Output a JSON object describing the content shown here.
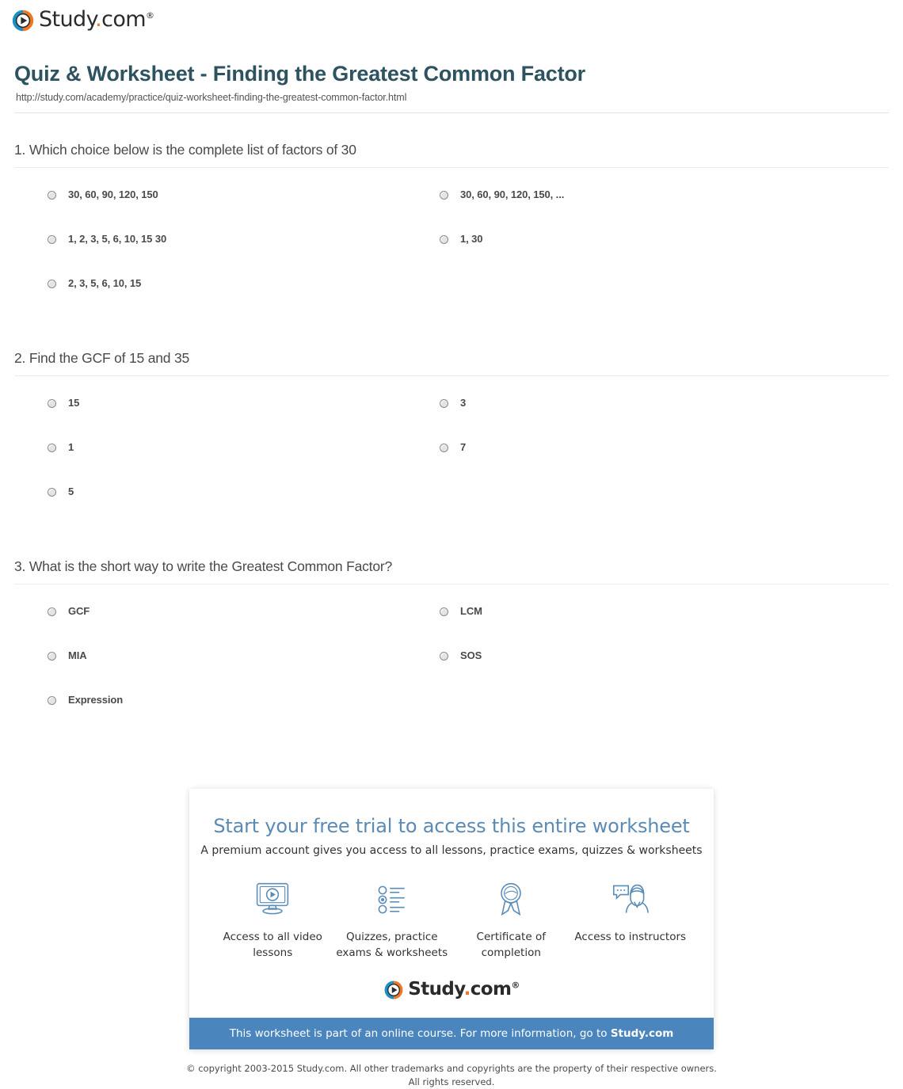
{
  "brand": {
    "name_main": "Study",
    "name_dot": ".",
    "name_tld": "com",
    "trademark": "®",
    "ring_blue": "#1b90c4",
    "ring_orange": "#ef7622",
    "play_color": "#2b2b2b"
  },
  "header": {
    "logo_icon": "play-circle-icon"
  },
  "title": {
    "heading": "Quiz & Worksheet - Finding the Greatest Common Factor",
    "url": "http://study.com/academy/practice/quiz-worksheet-finding-the-greatest-common-factor.html",
    "color": "#2d5260"
  },
  "questions": [
    {
      "number": "1.",
      "text": "1. Which choice below is the complete list of factors of 30",
      "options": [
        "30, 60, 90, 120, 150",
        "1, 2, 3, 5, 6, 10, 15 30",
        "2, 3, 5, 6, 10, 15",
        "30, 60, 90, 120, 150, ...",
        "1, 30"
      ]
    },
    {
      "number": "2.",
      "text": "2. Find the GCF of 15 and 35",
      "options": [
        "15",
        "1",
        "5",
        "3",
        "7"
      ]
    },
    {
      "number": "3.",
      "text": "3. What is the short way to write the Greatest Common Factor?",
      "options": [
        "GCF",
        "MIA",
        "Expression",
        "LCM",
        "SOS"
      ]
    }
  ],
  "promo": {
    "headline": "Start your free trial to access this entire worksheet",
    "headline_color": "#5b8bb5",
    "subtext": "A premium account gives you access to all lessons, practice exams, quizzes & worksheets",
    "features": [
      {
        "icon": "monitor-play-icon",
        "label": "Access to all video lessons"
      },
      {
        "icon": "quiz-list-icon",
        "label": "Quizzes, practice exams & worksheets"
      },
      {
        "icon": "award-ribbon-icon",
        "label": "Certificate of completion"
      },
      {
        "icon": "instructor-chat-icon",
        "label": "Access to instructors"
      }
    ],
    "banner_text_before": "This worksheet is part of an online course. For more information, go to ",
    "banner_link": "Study.com",
    "banner_color": "#4a86bd"
  },
  "footer": {
    "line1": "© copyright 2003-2015 Study.com. All other trademarks and copyrights are the property of their respective owners.",
    "line2": "All rights reserved."
  }
}
